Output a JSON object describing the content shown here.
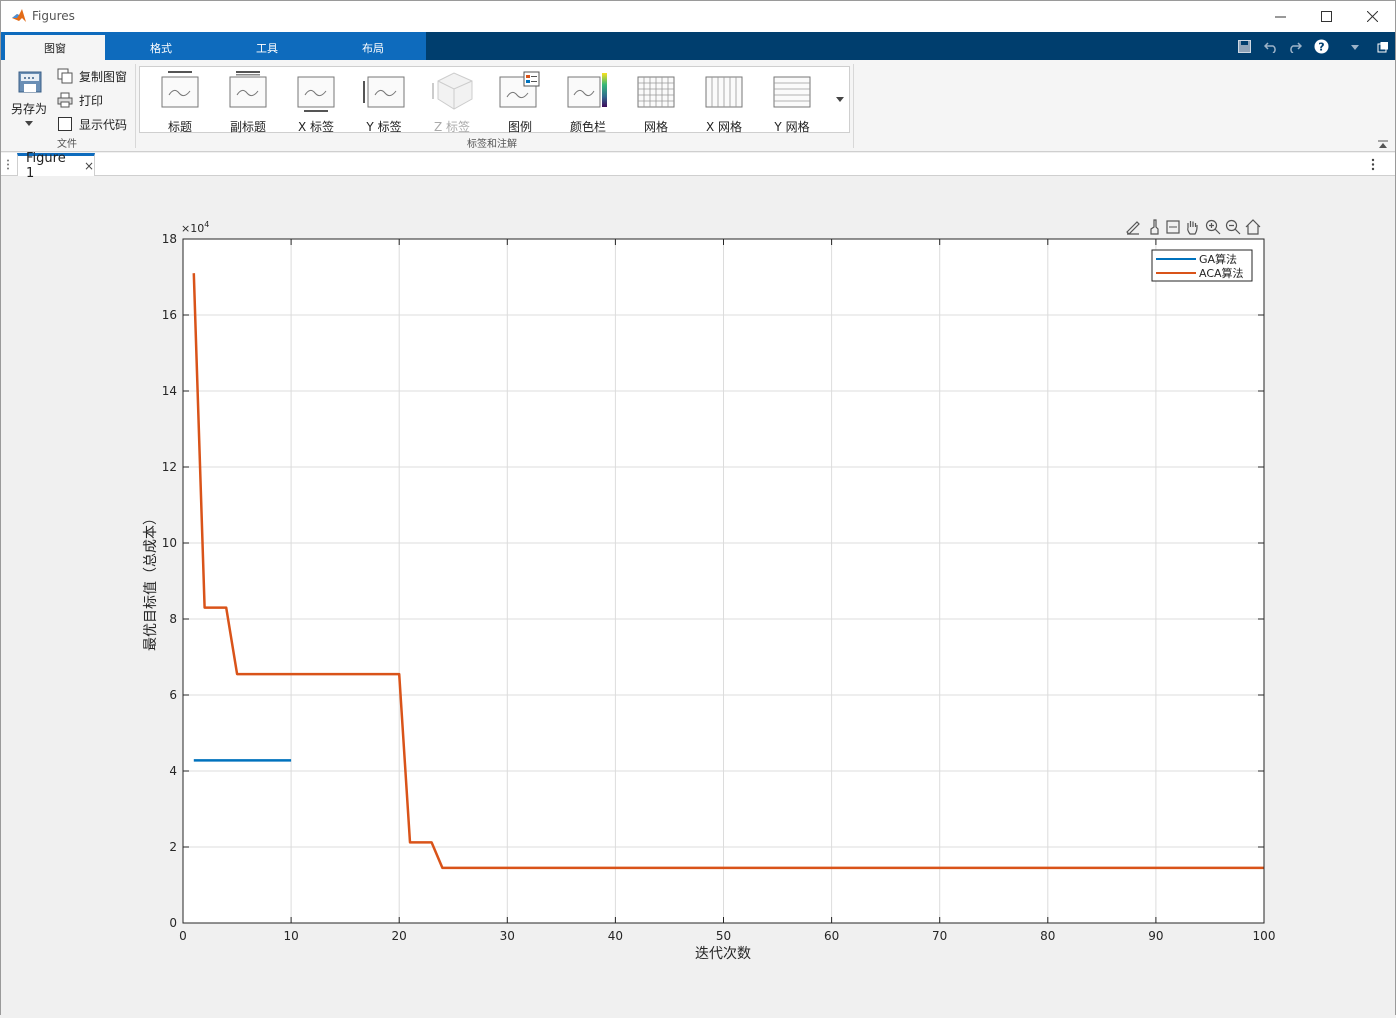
{
  "window": {
    "title": "Figures"
  },
  "ribbon_tabs": [
    "图窗",
    "格式",
    "工具",
    "布局"
  ],
  "file_section": {
    "label": "文件",
    "save_as": "另存为",
    "copy_figure": "复制图窗",
    "print": "打印",
    "show_code": "显示代码"
  },
  "annotations_section": {
    "label": "标签和注解",
    "items": [
      {
        "label": "标题",
        "icon": "title-icon",
        "enabled": true
      },
      {
        "label": "副标题",
        "icon": "subtitle-icon",
        "enabled": true
      },
      {
        "label": "X 标签",
        "icon": "xlabel-icon",
        "enabled": true
      },
      {
        "label": "Y 标签",
        "icon": "ylabel-icon",
        "enabled": true
      },
      {
        "label": "Z 标签",
        "icon": "zlabel-icon",
        "enabled": false
      },
      {
        "label": "图例",
        "icon": "legend-icon",
        "enabled": true
      },
      {
        "label": "颜色栏",
        "icon": "colorbar-icon",
        "enabled": true
      },
      {
        "label": "网格",
        "icon": "grid-icon",
        "enabled": true
      },
      {
        "label": "X 网格",
        "icon": "xgrid-icon",
        "enabled": true
      },
      {
        "label": "Y 网格",
        "icon": "ygrid-icon",
        "enabled": true
      }
    ]
  },
  "document_tab": {
    "label": "Figure 1",
    "close": "×"
  },
  "colors": {
    "accent": "#0e6bbd",
    "tabstrip": "#003e6e",
    "ga": "#0072bd",
    "aca": "#d95319"
  },
  "chart_data": {
    "type": "line",
    "title": "",
    "xlabel": "迭代次数",
    "ylabel": "最优目标值（总成本）",
    "xlim": [
      0,
      100
    ],
    "ylim": [
      0,
      180000
    ],
    "xticks": [
      0,
      10,
      20,
      30,
      40,
      50,
      60,
      70,
      80,
      90,
      100
    ],
    "yticks": [
      0,
      2,
      4,
      6,
      8,
      10,
      12,
      14,
      16,
      18
    ],
    "y_exponent": "×10",
    "y_exponent_power": "4",
    "grid": true,
    "legend_position": "top-right",
    "series": [
      {
        "name": "GA算法",
        "color": "#0072bd",
        "x": [
          1,
          10
        ],
        "y": [
          42800,
          42800
        ]
      },
      {
        "name": "ACA算法",
        "color": "#d95319",
        "x": [
          1,
          2,
          3,
          4,
          5,
          20,
          21,
          22,
          23,
          24,
          100
        ],
        "y": [
          171000,
          83000,
          83000,
          83000,
          65500,
          65500,
          21200,
          21200,
          21200,
          14500,
          14500
        ]
      }
    ]
  }
}
